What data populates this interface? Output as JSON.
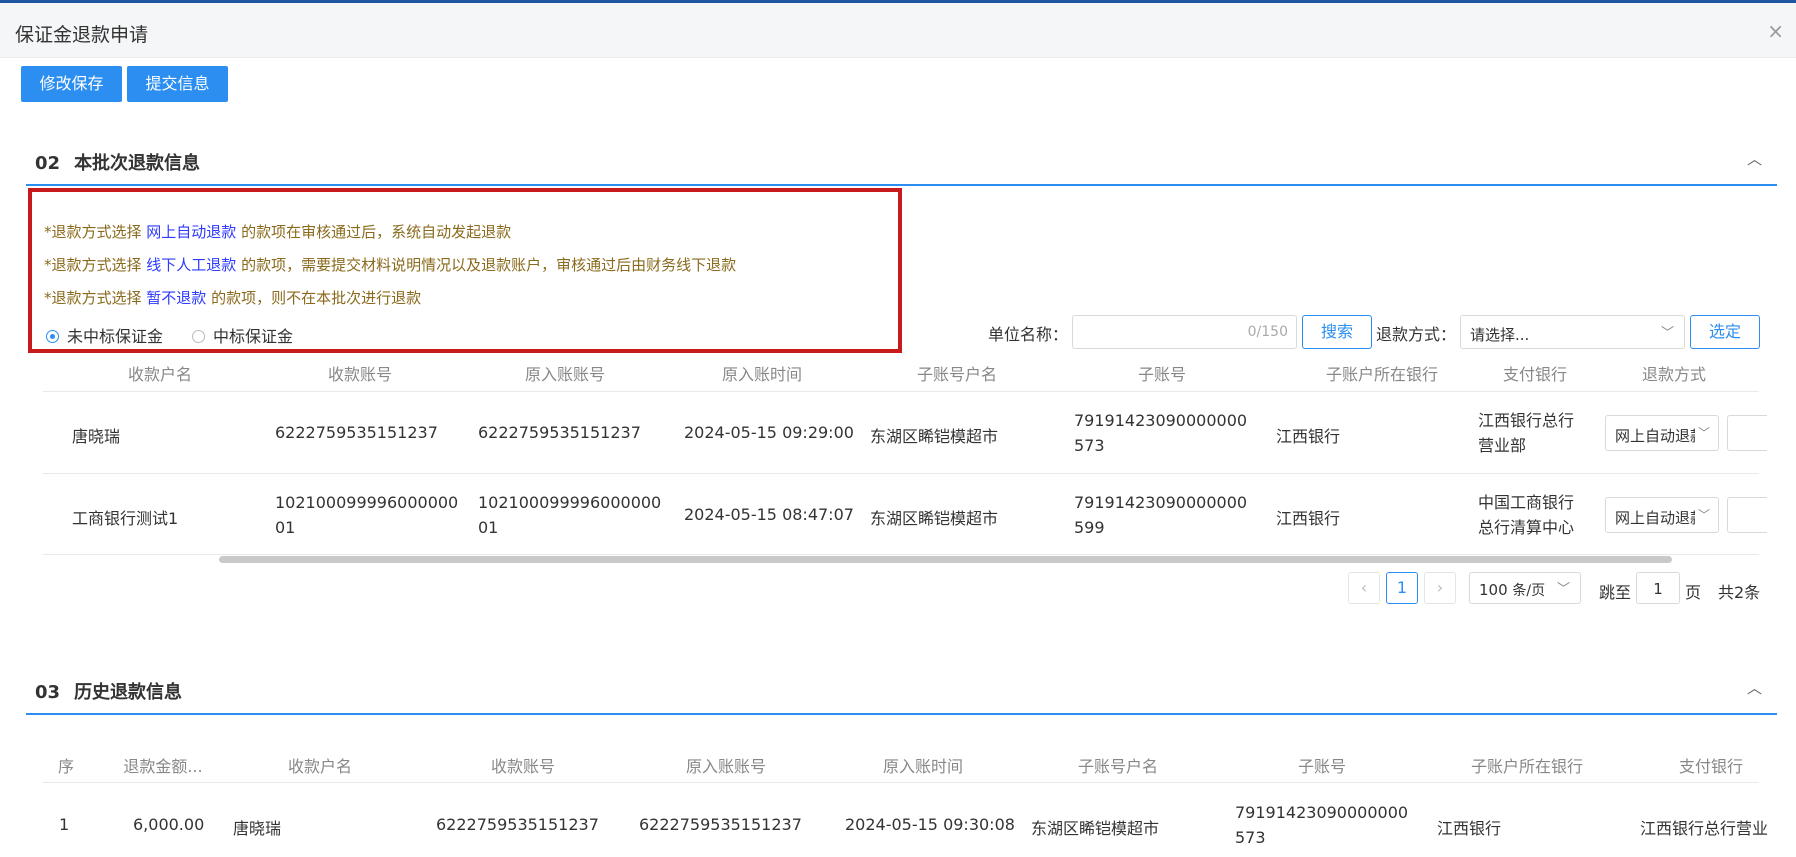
{
  "header": {
    "title": "保证金退款申请",
    "close": "×"
  },
  "actions": {
    "save": "修改保存",
    "submit": "提交信息"
  },
  "section2": {
    "num": "02",
    "title": "本批次退款信息",
    "collapse": "︿",
    "notes": [
      {
        "pre": "*退款方式选择 ",
        "hl": "网上自动退款",
        "post": " 的款项在审核通过后，系统自动发起退款"
      },
      {
        "pre": "*退款方式选择 ",
        "hl": "线下人工退款",
        "post": " 的款项，需要提交材料说明情况以及退款账户，审核通过后由财务线下退款"
      },
      {
        "pre": "*退款方式选择 ",
        "hl": "暂不退款",
        "post": " 的款项，则不在本批次进行退款"
      }
    ],
    "radios": [
      {
        "label": "未中标保证金",
        "checked": true
      },
      {
        "label": "中标保证金",
        "checked": false
      }
    ],
    "filter": {
      "unit_label": "单位名称：",
      "unit_counter": "0/150",
      "search_btn": "搜索",
      "method_label": "退款方式：",
      "method_placeholder": "请选择...",
      "confirm_btn": "选定"
    },
    "columns": [
      "收款户名",
      "收款账号",
      "原入账账号",
      "原入账时间",
      "子账号户名",
      "子账号",
      "子账户所在银行",
      "支付银行",
      "退款方式"
    ],
    "rows": [
      {
        "payee": "唐晓瑞",
        "account": "6222759535151237",
        "orig_account": "6222759535151237",
        "time": "2024-05-15 09:29:00",
        "sub_name": "东湖区睎铠模超市",
        "sub_account": "79191423090000000573",
        "sub_bank": "江西银行",
        "pay_bank": "江西银行总行营业部",
        "method": "网上自动退款"
      },
      {
        "payee": "工商银行测试1",
        "account": "10210009999600000001",
        "orig_account": "10210009999600000001",
        "time": "2024-05-15 08:47:07",
        "sub_name": "东湖区睎铠模超市",
        "sub_account": "79191423090000000599",
        "sub_bank": "江西银行",
        "pay_bank": "中国工商银行总行清算中心",
        "method": "网上自动退款"
      }
    ],
    "pagination": {
      "prev": "‹",
      "page": "1",
      "next": "›",
      "size": "100",
      "size_unit": "条/页",
      "jump_label": "跳至",
      "jump_value": "1",
      "page_unit": "页",
      "total": "共2条"
    }
  },
  "section3": {
    "num": "03",
    "title": "历史退款信息",
    "collapse": "︿",
    "columns": [
      "序",
      "退款金额...",
      "收款户名",
      "收款账号",
      "原入账账号",
      "原入账时间",
      "子账号户名",
      "子账号",
      "子账户所在银行",
      "支付银行"
    ],
    "rows": [
      {
        "seq": "1",
        "amount": "6,000.00",
        "payee": "唐晓瑞",
        "account": "6222759535151237",
        "orig_account": "6222759535151237",
        "time": "2024-05-15 09:30:08",
        "sub_name": "东湖区睎铠模超市",
        "sub_account": "79191423090000000573",
        "sub_bank": "江西银行",
        "pay_bank": "江西银行总行营业"
      }
    ]
  },
  "colors": {
    "primary": "#2b8ef0",
    "highlight_box": "#c81a1a",
    "note_text": "#8a6a1c",
    "note_highlight": "#2d3aff"
  }
}
